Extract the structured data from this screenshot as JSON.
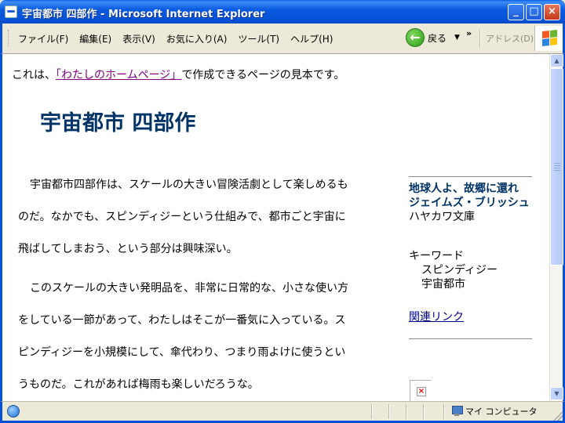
{
  "window": {
    "title": "宇宙都市 四部作 - Microsoft Internet Explorer",
    "minimize": "_",
    "maximize": "□",
    "close": "×"
  },
  "menu": {
    "items": [
      "ファイル(F)",
      "編集(E)",
      "表示(V)",
      "お気に入り(A)",
      "ツール(T)",
      "ヘルプ(H)"
    ],
    "back_label": "戻る",
    "back_dropdown": "▼",
    "chevron": "»",
    "address_label": "アドレス(D)"
  },
  "page": {
    "intro_before": "これは、",
    "intro_link": "「わたしのホームページ」",
    "intro_after": "で作成できるページの見本です。",
    "title": "宇宙都市 四部作",
    "paragraph1": "宇宙都市四部作は、スケールの大きい冒険活劇として楽しめるものだ。なかでも、スピンディジーという仕組みで、都市ごと宇宙に飛ばしてしまおう、という部分は興味深い。",
    "paragraph2": "このスケールの大きい発明品を、非常に日常的な、小さな使い方をしている一節があって、わたしはそこが一番気に入っている。スピンディジーを小規模にして、傘代わり、つまり雨よけに使うというものだ。これがあれば梅雨も楽しいだろうな。"
  },
  "sidebar": {
    "book_title": "地球人よ、故郷に還れ",
    "author": "ジェイムズ・ブリッシュ",
    "publisher": "ハヤカワ文庫",
    "keyword_label": "キーワード",
    "keywords": [
      "スピンディジー",
      "宇宙都市"
    ],
    "related_link": "関連リンク",
    "broken_image_mark": "×"
  },
  "scrollbar": {
    "up": "▲",
    "down": "▼"
  },
  "status": {
    "zone": "マイ コンピュータ"
  }
}
